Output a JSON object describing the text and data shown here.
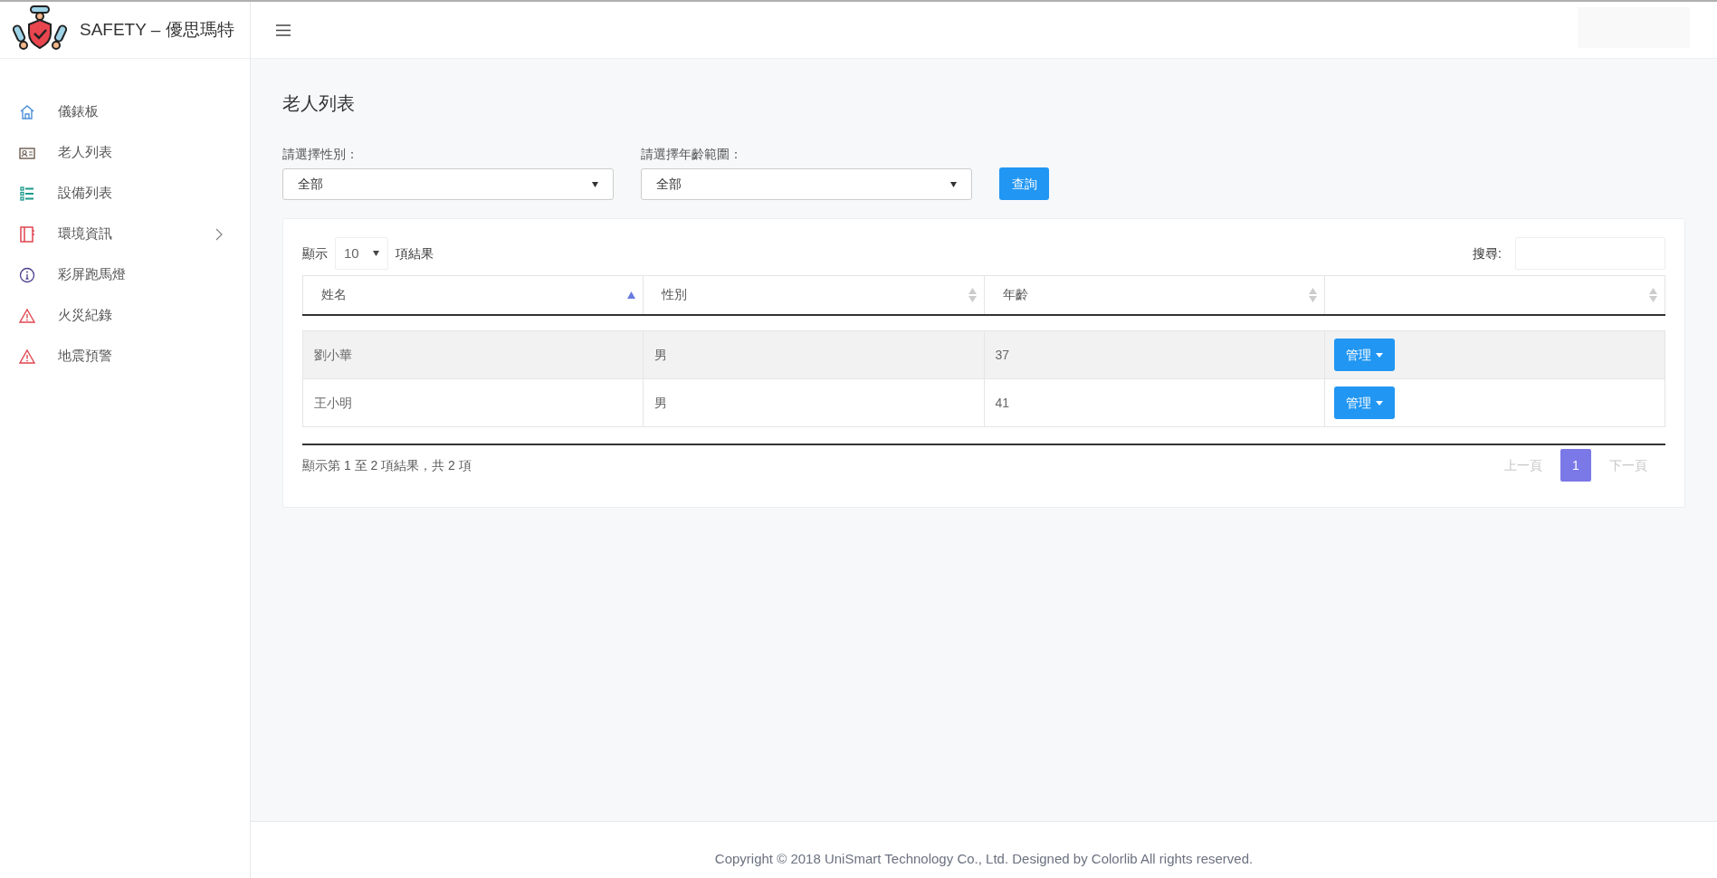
{
  "brand": {
    "title": "SAFETY – 優思瑪特"
  },
  "sidebar": {
    "items": [
      {
        "label": "儀錶板",
        "kind": "home",
        "has_submenu": false
      },
      {
        "label": "老人列表",
        "kind": "card",
        "has_submenu": false
      },
      {
        "label": "設備列表",
        "kind": "list",
        "has_submenu": false
      },
      {
        "label": "環境資訊",
        "kind": "notebook",
        "has_submenu": true
      },
      {
        "label": "彩屏跑馬燈",
        "kind": "info",
        "has_submenu": false
      },
      {
        "label": "火災紀錄",
        "kind": "warning",
        "has_submenu": false
      },
      {
        "label": "地震預警",
        "kind": "warning",
        "has_submenu": false
      }
    ]
  },
  "page_title": "老人列表",
  "filters": [
    {
      "label": "請選擇性別：",
      "value": "全部"
    },
    {
      "label": "請選擇年齡範圍：",
      "value": "全部"
    }
  ],
  "query_button": "查詢",
  "table": {
    "length_prefix": "顯示",
    "length_value": "10",
    "length_suffix": "項結果",
    "search_label": "搜尋:",
    "columns": [
      {
        "label": "姓名",
        "sorted": true
      },
      {
        "label": "性別",
        "sorted": false
      },
      {
        "label": "年齡",
        "sorted": false
      },
      {
        "sorted": false
      }
    ],
    "rows": [
      {
        "name": "劉小華",
        "gender": "男",
        "age": "37",
        "action": "管理"
      },
      {
        "name": "王小明",
        "gender": "男",
        "age": "41",
        "action": "管理"
      }
    ],
    "info": "顯示第 1 至 2 項結果，共 2 項",
    "pagination": {
      "previous": {
        "label": "上一頁",
        "disabled": true
      },
      "pages": [
        {
          "label": "1",
          "selected": true
        }
      ],
      "next": {
        "label": "下一頁",
        "disabled": true
      }
    }
  },
  "footer": "Copyright © 2018 UniSmart Technology Co., Ltd. Designed by Colorlib All rights reserved."
}
